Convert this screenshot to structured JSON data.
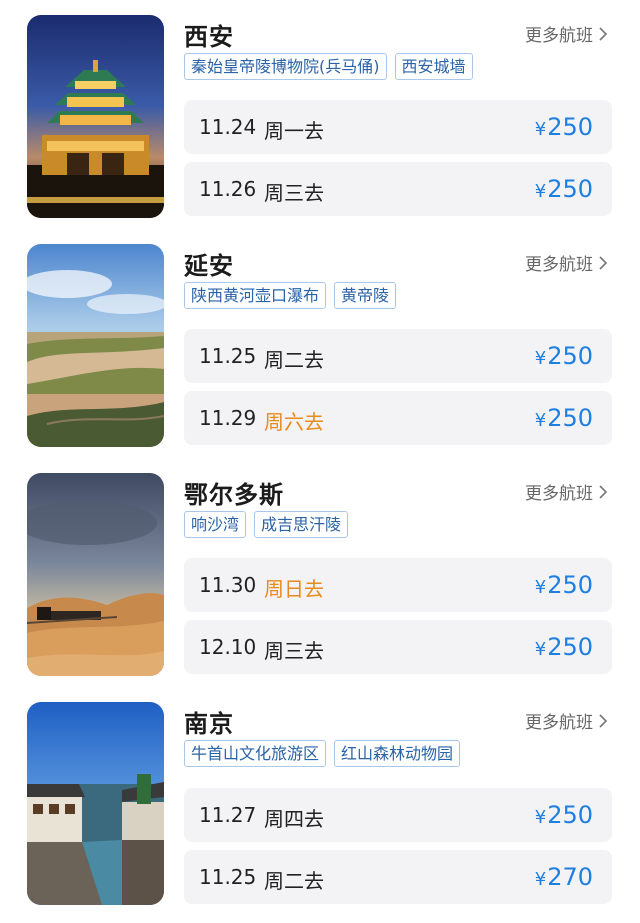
{
  "more_label": "更多航班",
  "colors": {
    "price": "#1f7fe0",
    "weekend": "#e98a1c",
    "tag_text": "#2a63a8"
  },
  "destinations": [
    {
      "city": "西安",
      "image": "xian-bell-tower-night-photo",
      "tags": [
        "秦始皇帝陵博物院(兵马俑)",
        "西安城墙"
      ],
      "flights": [
        {
          "date": "11.24",
          "day": "周一去",
          "currency": "¥",
          "price": "250",
          "weekend": false
        },
        {
          "date": "11.26",
          "day": "周三去",
          "currency": "¥",
          "price": "250",
          "weekend": false
        }
      ]
    },
    {
      "city": "延安",
      "image": "yellow-river-landscape-photo",
      "tags": [
        "陕西黄河壶口瀑布",
        "黄帝陵"
      ],
      "flights": [
        {
          "date": "11.25",
          "day": "周二去",
          "currency": "¥",
          "price": "250",
          "weekend": false
        },
        {
          "date": "11.29",
          "day": "周六去",
          "currency": "¥",
          "price": "250",
          "weekend": true
        }
      ]
    },
    {
      "city": "鄂尔多斯",
      "image": "desert-train-photo",
      "tags": [
        "响沙湾",
        "成吉思汗陵"
      ],
      "flights": [
        {
          "date": "11.30",
          "day": "周日去",
          "currency": "¥",
          "price": "250",
          "weekend": true
        },
        {
          "date": "12.10",
          "day": "周三去",
          "currency": "¥",
          "price": "250",
          "weekend": false
        }
      ]
    },
    {
      "city": "南京",
      "image": "water-town-canal-photo",
      "tags": [
        "牛首山文化旅游区",
        "红山森林动物园"
      ],
      "flights": [
        {
          "date": "11.27",
          "day": "周四去",
          "currency": "¥",
          "price": "250",
          "weekend": false
        },
        {
          "date": "11.25",
          "day": "周二去",
          "currency": "¥",
          "price": "270",
          "weekend": false
        }
      ]
    }
  ]
}
